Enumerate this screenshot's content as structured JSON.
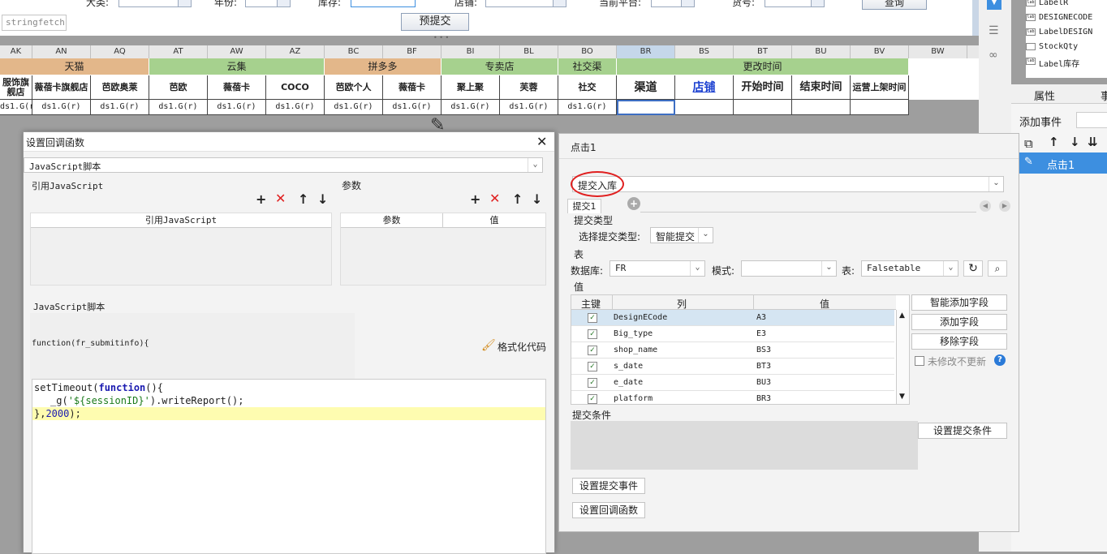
{
  "topbar": {
    "labels": [
      "大类:",
      "年份:",
      "库存:",
      "店铺:",
      "当前平台:",
      "货号:"
    ],
    "stringfetch": "stringfetch(",
    "pre_submit": "预提交",
    "query": "查询"
  },
  "grid": {
    "columns": [
      "AK",
      "AN",
      "AQ",
      "AT",
      "AW",
      "AZ",
      "BC",
      "BF",
      "BI",
      "BL",
      "BO",
      "BR",
      "BS",
      "BT",
      "BU",
      "BV",
      "BW"
    ],
    "groups": [
      "天猫",
      "云集",
      "拼多多",
      "专卖店",
      "社交渠",
      "更改时间"
    ],
    "subheaders": [
      "服饰旗舰店",
      "薇蓓卡旗舰店",
      "芭欧奥莱",
      "芭欧",
      "薇蓓卡",
      "COCO",
      "芭欧个人",
      "薇蓓卡",
      "聚上聚",
      "芙蓉",
      "社交",
      "渠道",
      "店铺",
      "开始时间",
      "结束时间",
      "运营上架时间"
    ],
    "cell_value": "ds1.G(r)"
  },
  "tree": {
    "items": [
      "LabelR",
      "DESIGNECODE",
      "LabelDESIGN",
      "StockQty",
      "Label库存"
    ]
  },
  "props": {
    "tab_attr": "属性",
    "tab_event": "事",
    "add_event": "添加事件",
    "event_item": "点击1"
  },
  "left_dialog": {
    "title": "设置回调函数",
    "script_type": "JavaScript脚本",
    "ref_js_label": "引用JavaScript",
    "params_label": "参数",
    "ref_js_col": "引用JavaScript",
    "param_col": "参数",
    "value_col": "值",
    "js_script_label": "JavaScript脚本",
    "func_sig": "function(fr_submitinfo){",
    "format_code": "格式化代码",
    "code_line1_a": "setTimeout(",
    "code_line1_kw": "function",
    "code_line1_b": "(){",
    "code_line2_a": "_g(",
    "code_line2_str": "'${sessionID}'",
    "code_line2_b": ").writeReport();",
    "code_line3_a": "},",
    "code_line3_num": "2000",
    "code_line3_b": ");"
  },
  "right_dialog": {
    "title": "点击1",
    "action": "提交入库",
    "tab": "提交1",
    "submit_type_label": "提交类型",
    "select_type_label": "选择提交类型:",
    "select_type_value": "智能提交",
    "table_section": "表",
    "db_label": "数据库:",
    "db_value": "FR",
    "schema_label": "模式:",
    "table_label": "表:",
    "table_value": "Falsetable",
    "value_section": "值",
    "col_pk": "主键",
    "col_col": "列",
    "col_val": "值",
    "rows": [
      {
        "col": "DesignECode",
        "val": "A3"
      },
      {
        "col": "Big_type",
        "val": "E3"
      },
      {
        "col": "shop_name",
        "val": "BS3"
      },
      {
        "col": "s_date",
        "val": "BT3"
      },
      {
        "col": "e_date",
        "val": "BU3"
      },
      {
        "col": "platform",
        "val": "BR3"
      }
    ],
    "smart_add": "智能添加字段",
    "add_field": "添加字段",
    "remove_field": "移除字段",
    "no_update": "未修改不更新",
    "submit_cond_label": "提交条件",
    "set_cond": "设置提交条件",
    "set_event": "设置提交事件",
    "set_callback": "设置回调函数"
  },
  "colors": {
    "tmall": "#e3b78a",
    "yunji": "#a6d18e",
    "pdd": "#e3b78a",
    "store": "#a6d18e",
    "social": "#a6d18e",
    "change": "#a6d18e",
    "accent": "#3d8fe0",
    "circle": "#e02020"
  }
}
